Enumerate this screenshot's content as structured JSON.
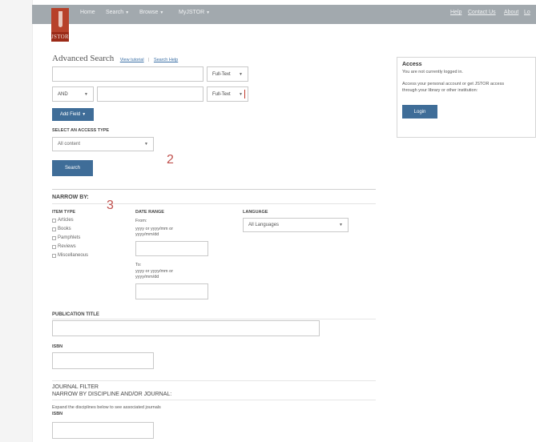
{
  "nav": {
    "home": "Home",
    "search": "Search",
    "browse": "Browse",
    "myjstor": "MyJSTOR",
    "help": "Help",
    "contact": "Contact Us",
    "about": "About",
    "login_partial": "Lo"
  },
  "logo": {
    "text": "JSTOR"
  },
  "header": {
    "title": "Advanced Search",
    "tutorial_link": "View tutorial",
    "search_help_link": "Search Help",
    "separator": "|"
  },
  "search_rows": [
    {
      "value": "",
      "field_select": "Full-Text"
    },
    {
      "operator": "AND",
      "value": "",
      "field_select": "Full-Text"
    }
  ],
  "add_field_label": "Add Field",
  "access_type": {
    "label": "SELECT AN ACCESS TYPE",
    "selected": "All content"
  },
  "search_button": "Search",
  "annotations": {
    "two": "2",
    "three": "3"
  },
  "narrow_by": {
    "heading": "NARROW BY:",
    "item_type": {
      "label": "ITEM TYPE",
      "options": [
        "Articles",
        "Books",
        "Pamphlets",
        "Reviews",
        "Miscellaneous"
      ]
    },
    "date_range": {
      "label": "DATE RANGE",
      "from_label": "From:",
      "from_hint": "yyyy or yyyy/mm or yyyy/mm/dd",
      "to_label": "To:",
      "to_hint": "yyyy or yyyy/mm or yyyy/mm/dd"
    },
    "language": {
      "label": "LANGUAGE",
      "selected": "All Languages"
    }
  },
  "publication_title": {
    "label": "PUBLICATION TITLE",
    "value": ""
  },
  "isbn": {
    "label": "ISBN",
    "value": ""
  },
  "journal_filter": {
    "label": "JOURNAL FILTER",
    "heading": "NARROW BY DISCIPLINE AND/OR JOURNAL:",
    "hint": "Expand the disciplines below to see associated journals",
    "isbn_label": "ISBN"
  },
  "access_box": {
    "title": "Access",
    "line1": "You are not currently logged in.",
    "line2": "Access your personal account or get JSTOR access",
    "line3": "through your library or other institution:",
    "login_button": "Login"
  },
  "colors": {
    "topbar": "#a2a9ae",
    "button": "#3f6d98",
    "logo": "#9b2a17",
    "annotation": "#c0504d"
  }
}
